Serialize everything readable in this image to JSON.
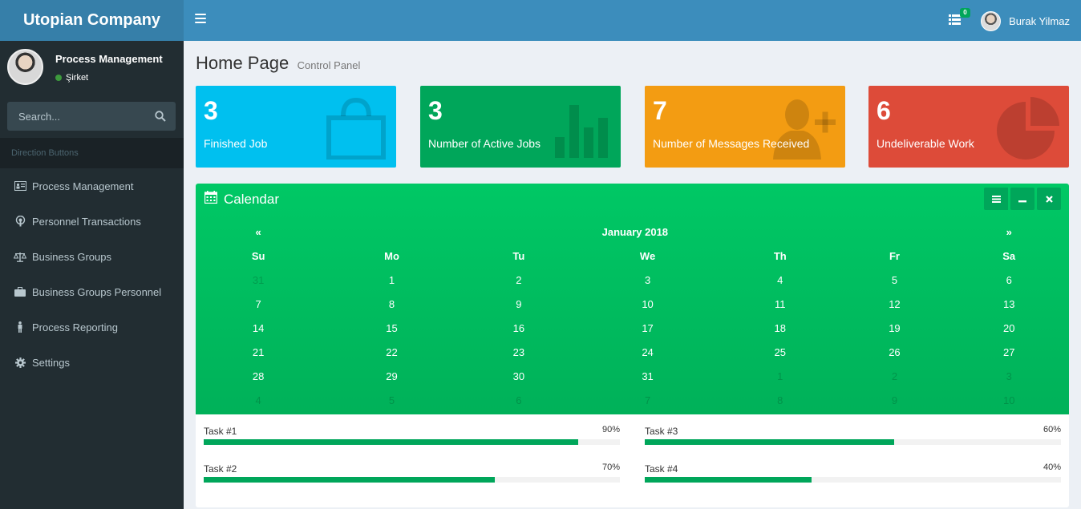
{
  "app": {
    "brand": "Utopian Company",
    "notifications_count": "0",
    "user_name": "Burak Yilmaz"
  },
  "sidebar": {
    "user_title": "Process Management",
    "user_status": "Şirket",
    "search_placeholder": "Search...",
    "section_header": "Direction Buttons",
    "items": [
      {
        "label": "Process Management",
        "icon": "id-card-icon"
      },
      {
        "label": "Personnel Transactions",
        "icon": "podcast-icon"
      },
      {
        "label": "Business Groups",
        "icon": "balance-scale-icon"
      },
      {
        "label": "Business Groups Personnel",
        "icon": "briefcase-icon"
      },
      {
        "label": "Process Reporting",
        "icon": "male-icon"
      },
      {
        "label": "Settings",
        "icon": "gear-icon"
      }
    ]
  },
  "page": {
    "title": "Home Page",
    "subtitle": "Control Panel"
  },
  "stats": [
    {
      "value": "3",
      "label": "Finished Job",
      "color": "#00c0ef",
      "icon": "shopping-bag-icon"
    },
    {
      "value": "3",
      "label": "Number of Active Jobs",
      "color": "#00a65a",
      "icon": "bar-chart-icon"
    },
    {
      "value": "7",
      "label": "Number of Messages Received",
      "color": "#f39c12",
      "icon": "user-plus-icon"
    },
    {
      "value": "6",
      "label": "Undeliverable Work",
      "color": "#dd4b39",
      "icon": "pie-chart-icon"
    }
  ],
  "calendar": {
    "title": "Calendar",
    "month": "January 2018",
    "prev": "«",
    "next": "»",
    "weekdays": [
      "Su",
      "Mo",
      "Tu",
      "We",
      "Th",
      "Fr",
      "Sa"
    ],
    "weeks": [
      [
        {
          "d": "31",
          "m": true
        },
        {
          "d": "1"
        },
        {
          "d": "2"
        },
        {
          "d": "3"
        },
        {
          "d": "4"
        },
        {
          "d": "5"
        },
        {
          "d": "6"
        }
      ],
      [
        {
          "d": "7"
        },
        {
          "d": "8"
        },
        {
          "d": "9"
        },
        {
          "d": "10"
        },
        {
          "d": "11"
        },
        {
          "d": "12"
        },
        {
          "d": "13"
        }
      ],
      [
        {
          "d": "14"
        },
        {
          "d": "15"
        },
        {
          "d": "16"
        },
        {
          "d": "17"
        },
        {
          "d": "18"
        },
        {
          "d": "19"
        },
        {
          "d": "20"
        }
      ],
      [
        {
          "d": "21"
        },
        {
          "d": "22"
        },
        {
          "d": "23"
        },
        {
          "d": "24"
        },
        {
          "d": "25"
        },
        {
          "d": "26"
        },
        {
          "d": "27"
        }
      ],
      [
        {
          "d": "28"
        },
        {
          "d": "29"
        },
        {
          "d": "30"
        },
        {
          "d": "31"
        },
        {
          "d": "1",
          "m": true
        },
        {
          "d": "2",
          "m": true
        },
        {
          "d": "3",
          "m": true
        }
      ],
      [
        {
          "d": "4",
          "m": true
        },
        {
          "d": "5",
          "m": true
        },
        {
          "d": "6",
          "m": true
        },
        {
          "d": "7",
          "m": true
        },
        {
          "d": "8",
          "m": true
        },
        {
          "d": "9",
          "m": true
        },
        {
          "d": "10",
          "m": true
        }
      ]
    ]
  },
  "tasks": [
    {
      "name": "Task #1",
      "percent_label": "90%",
      "percent": 90
    },
    {
      "name": "Task #3",
      "percent_label": "60%",
      "percent": 60
    },
    {
      "name": "Task #2",
      "percent_label": "70%",
      "percent": 70
    },
    {
      "name": "Task #4",
      "percent_label": "40%",
      "percent": 40
    }
  ]
}
